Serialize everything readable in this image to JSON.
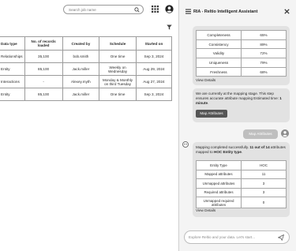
{
  "search": {
    "placeholder": "Search job name"
  },
  "table": {
    "headers": [
      "Data type",
      "No. of records loaded",
      "Created by",
      "Schedule",
      "Started on"
    ],
    "rows": [
      [
        "Relationships",
        "35,100",
        "bob.smith",
        "One time",
        "Sep 3, 2024"
      ],
      [
        "Entity",
        "85,100",
        "Jack.miller",
        "Weekly on Wednesday",
        "Aug 29, 2024"
      ],
      [
        "Interactions",
        "-",
        "Alexey.myth",
        "Monday & Monthly on third Tuesday",
        "Aug 27, 2024"
      ],
      [
        "Entity",
        "85,100",
        "Jack.miller",
        "One time",
        "Sep 3, 2024"
      ]
    ]
  },
  "assistant": {
    "title": "RIA - Reltio Intelligent Assistant",
    "metrics": [
      {
        "name": "Completeness",
        "value": "65%"
      },
      {
        "name": "Consistency",
        "value": "89%"
      },
      {
        "name": "Validity",
        "value": "72%"
      },
      {
        "name": "Uniqueness",
        "value": "79%"
      },
      {
        "name": "Freshness",
        "value": "68%"
      }
    ],
    "view_details_1": "View Details",
    "mapping_message_prefix": "We are currently at the mapping stage. This step ensures accurate attribute mapping",
    "estimated_time_label": "Estimated time:",
    "estimated_time_value": "1 minute",
    "map_button": "Map Attributes",
    "user_message": "Map Attributes",
    "completion_prefix": "Mapping completed successfully.",
    "completion_count": "11 out of 14",
    "completion_middle": "attributes mapped to",
    "completion_entity": "HOC Entity type",
    "summary": [
      {
        "name": "Entity Type",
        "value": "HOC"
      },
      {
        "name": "Mapped attributes",
        "value": "11"
      },
      {
        "name": "Unmapped attributes",
        "value": "3"
      },
      {
        "name": "Required attributes",
        "value": "3"
      },
      {
        "name": "Unmapped required attributes",
        "value": "0"
      }
    ],
    "view_details_2": "View Details",
    "composer_placeholder": "Explore Reltio and your data. Let's start..."
  },
  "colors": {
    "accent_dark": "#555555",
    "panel_bg": "#f4f4f4",
    "card_bg": "#e2e2e2"
  }
}
